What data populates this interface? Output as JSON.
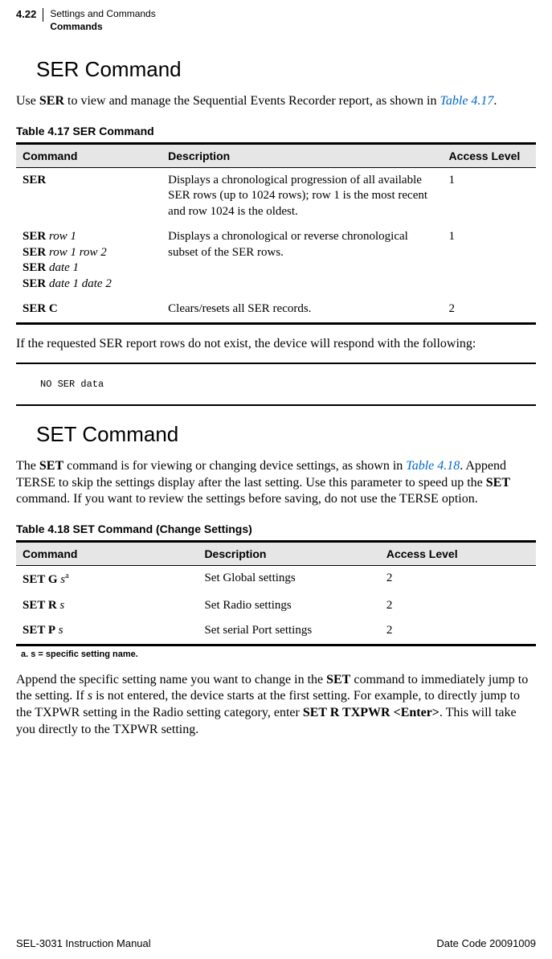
{
  "header": {
    "page_num": "4.22",
    "title": "Settings and Commands",
    "subtitle": "Commands"
  },
  "ser": {
    "heading": "SER Command",
    "intro_a": "Use ",
    "intro_b": "SER",
    "intro_c": " to view and manage the Sequential Events Recorder report, as shown in ",
    "intro_link": "Table 4.17",
    "intro_d": ".",
    "table_caption": "Table 4.17    SER Command",
    "th_cmd": "Command",
    "th_desc": "Description",
    "th_acc": "Access Level",
    "rows": [
      {
        "cmd_html": "<b>SER</b>",
        "desc": "Displays a chronological progression of all available SER rows (up to 1024 rows); row 1 is the most recent and row 1024 is the oldest.",
        "acc": "1"
      },
      {
        "cmd_html": "<b>SER</b> <i>row 1</i><br><b>SER</b> <i>row 1 row 2</i><br><b>SER</b> <i>date 1</i><br><b>SER</b> <i>date 1 date 2</i>",
        "desc": "Displays a chronological or reverse chronological subset of the SER rows.",
        "acc": "1"
      },
      {
        "cmd_html": "<b>SER C</b>",
        "desc": "Clears/resets all SER records.",
        "acc": "2"
      }
    ],
    "after": "If the requested SER report rows do not exist, the device will respond with the following:",
    "code": "NO SER data"
  },
  "set": {
    "heading": "SET Command",
    "intro_a": "The ",
    "intro_b": "SET",
    "intro_c": " command is for viewing or changing device settings, as shown in ",
    "intro_link": "Table 4.18",
    "intro_d": ". Append TERSE to skip the settings display after the last setting. Use this parameter to speed up the ",
    "intro_e": "SET",
    "intro_f": " command. If you want to review the settings before saving, do not use the TERSE option.",
    "table_caption": "Table 4.18    SET Command (Change Settings)",
    "th_cmd": "Command",
    "th_desc": "Description",
    "th_acc": "Access Level",
    "rows": [
      {
        "cmd_html": "<b>SET G</b> <i>s</i><sup>a</sup>",
        "desc": "Set Global settings",
        "acc": "2"
      },
      {
        "cmd_html": "<b>SET R</b> <i>s</i>",
        "desc": "Set Radio settings",
        "acc": "2"
      },
      {
        "cmd_html": "<b>SET P</b> <i>s</i>",
        "desc": "Set serial Port settings",
        "acc": "2"
      }
    ],
    "footnote": "a. s = specific setting name.",
    "after_a": "Append the specific setting name you want to change in the ",
    "after_b": "SET",
    "after_c": " command to immediately jump to the setting. If ",
    "after_d": "s",
    "after_e": " is not entered, the device starts at the first setting. For example, to directly jump to the TXPWR setting in the Radio setting category, enter ",
    "after_f": "SET R TXPWR <Enter>",
    "after_g": ". This will take you directly to the TXPWR setting."
  },
  "footer": {
    "left": "SEL-3031 Instruction Manual",
    "right": "Date Code 20091009"
  }
}
